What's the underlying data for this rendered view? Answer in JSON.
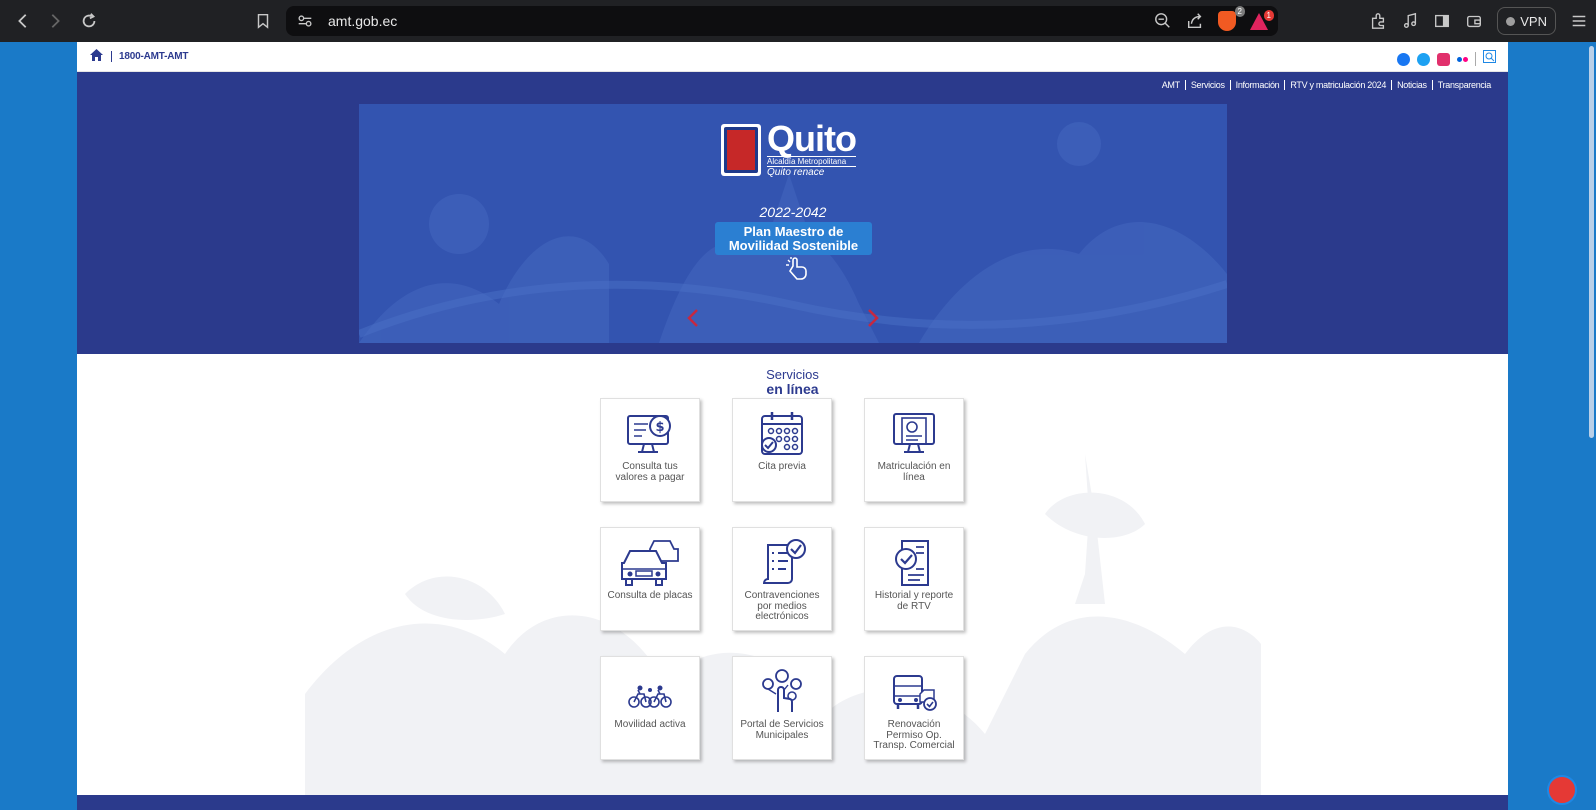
{
  "browser": {
    "url": "amt.gob.ec",
    "brave_badge": "2",
    "rewards_badge": "1",
    "vpn_label": "VPN"
  },
  "site": {
    "phone": "1800-AMT-AMT",
    "menu": [
      "AMT",
      "Servicios",
      "Información",
      "RTV y matriculación 2024",
      "Noticias",
      "Transparencia"
    ]
  },
  "banner": {
    "logo_title": "Quito",
    "logo_subtitle": "Alcaldía Metropolitana",
    "logo_motto": "Quito renace",
    "year": "2022-2042",
    "plan_line1": "Plan Maestro de",
    "plan_line2": "Movilidad Sostenible"
  },
  "services": {
    "title1": "Servicios",
    "title2": "en línea",
    "cards": [
      {
        "label": "Consulta tus valores a pagar",
        "icon": "monitor-dollar-icon"
      },
      {
        "label": "Cita previa",
        "icon": "calendar-icon"
      },
      {
        "label": "Matriculación en línea",
        "icon": "monitor-document-icon"
      },
      {
        "label": "Consulta de placas",
        "icon": "cars-icon"
      },
      {
        "label": "Contravenciones por medios electrónicos",
        "icon": "checklist-scroll-icon"
      },
      {
        "label": "Historial y reporte de RTV",
        "icon": "report-check-icon"
      },
      {
        "label": "Movilidad activa",
        "icon": "bicycles-icon"
      },
      {
        "label": "Portal de Servicios Municipales",
        "icon": "touch-portal-icon"
      },
      {
        "label": "Renovación Permiso Op. Transp. Comercial",
        "icon": "bus-check-icon"
      }
    ]
  },
  "colors": {
    "navy": "#2b3a8c",
    "banner_blue": "#3354b0",
    "accent_blue": "#2b7fd2",
    "outer_bg": "#1a7ac8"
  }
}
